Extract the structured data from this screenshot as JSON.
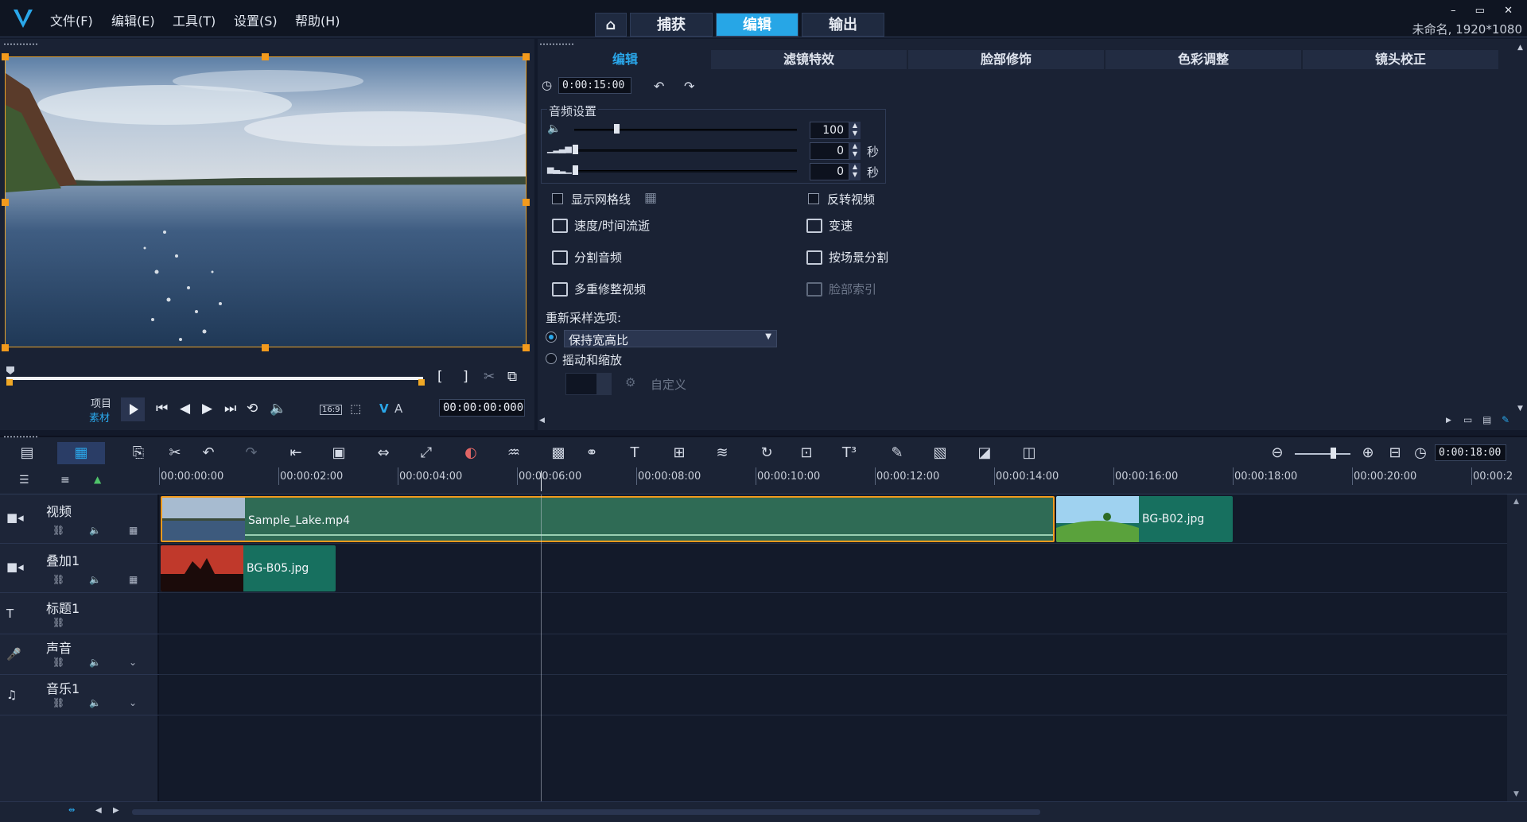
{
  "menu": [
    "文件(F)",
    "编辑(E)",
    "工具(T)",
    "设置(S)",
    "帮助(H)"
  ],
  "mode_tabs": {
    "home": "⌂",
    "capture": "捕获",
    "edit": "编辑",
    "output": "输出"
  },
  "project_info": "未命名, 1920*1080",
  "window_controls": "– ▭ ✕",
  "preview": {
    "project_label": "项目",
    "clip_label": "素材",
    "timecode": "00:00:00:000",
    "aspect": "16:9",
    "v_label": "V",
    "a_label": "A",
    "mark_in": "[",
    "mark_out": "]"
  },
  "options": {
    "tabs": [
      "编辑",
      "滤镜特效",
      "脸部修饰",
      "色彩调整",
      "镜头校正"
    ],
    "duration": "0:00:15:00",
    "audio_section": "音频设置",
    "volume": "100",
    "fade_in": "0",
    "fade_out": "0",
    "sec_unit": "秒",
    "show_grid": "显示网格线",
    "reverse_video": "反转视频",
    "speed_time": "速度/时间流逝",
    "variable_speed": "变速",
    "split_audio": "分割音频",
    "split_by_scene": "按场景分割",
    "multi_trim": "多重修整视频",
    "face_index": "脸部索引",
    "resample_label": "重新采样选项:",
    "keep_aspect": "保持宽高比",
    "pan_zoom": "摇动和缩放",
    "custom": "自定义"
  },
  "timeline": {
    "end_timecode": "0:00:18:00",
    "ticks": [
      "00:00:00:00",
      "00:00:02:00",
      "00:00:04:00",
      "00:00:06:00",
      "00:00:08:00",
      "00:00:10:00",
      "00:00:12:00",
      "00:00:14:00",
      "00:00:16:00",
      "00:00:18:00",
      "00:00:20:00",
      "00:00:2"
    ],
    "tracks": [
      "视频",
      "叠加1",
      "标题1",
      "声音",
      "音乐1"
    ],
    "clips": {
      "video1": "Sample_Lake.mp4",
      "video2": "BG-B02.jpg",
      "overlay1": "BG-B05.jpg"
    }
  },
  "colors": {
    "accent": "#27a6e6",
    "video_clip": "#2f6b55",
    "image_clip": "#17705f",
    "selection": "#f39a1c"
  }
}
